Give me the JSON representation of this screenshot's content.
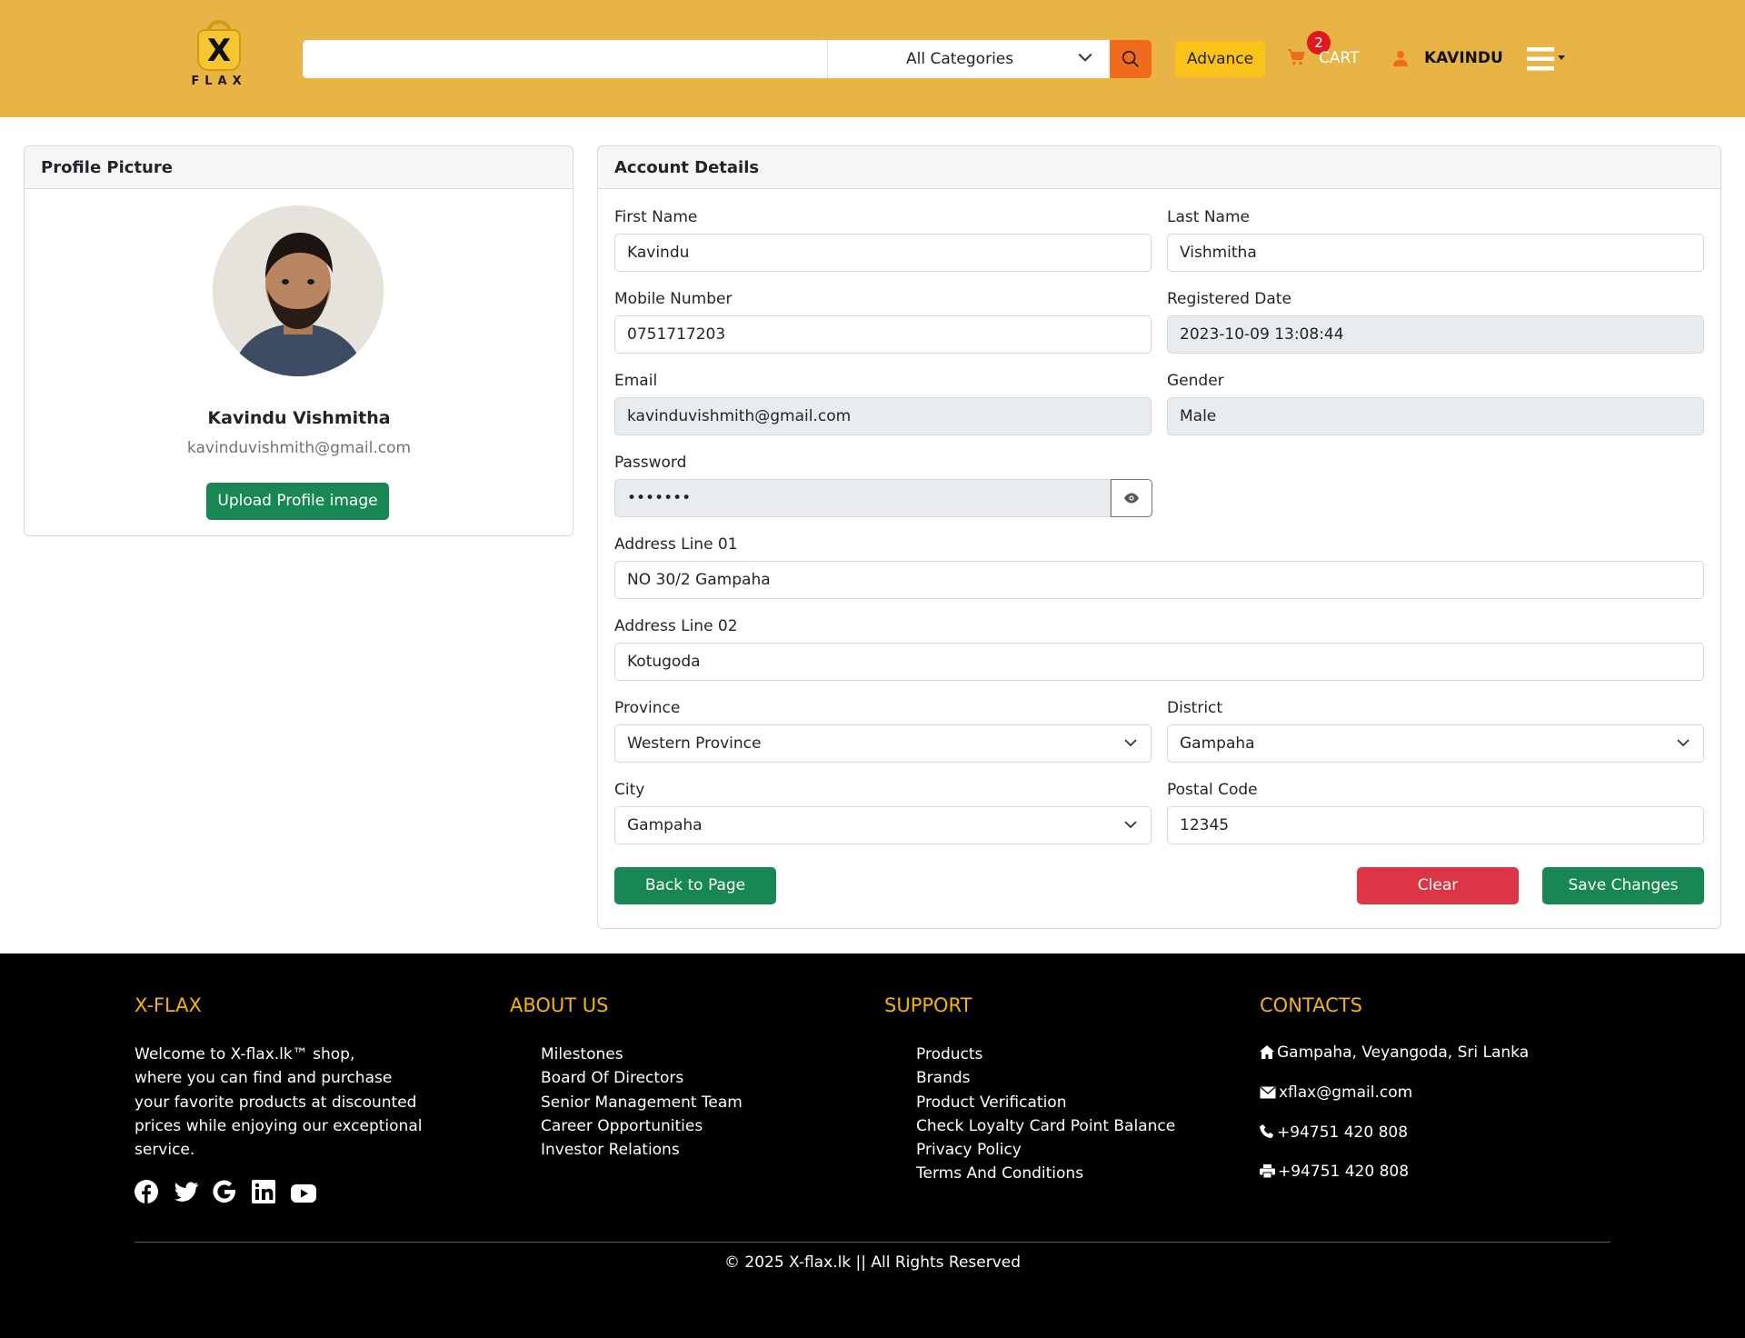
{
  "header": {
    "logo": {
      "letter": "X",
      "word": "FLAX"
    },
    "search": {
      "placeholder": "",
      "value": ""
    },
    "category": "All Categories",
    "advance_label": "Advance",
    "cart": {
      "label": "CART",
      "count": "2"
    },
    "user_label": "KAVINDU",
    "accent": "#e8b446"
  },
  "profile": {
    "card_title": "Profile Picture",
    "name": "Kavindu Vishmitha",
    "email": "kavinduvishmith@gmail.com",
    "upload_label": "Upload Profile image"
  },
  "account": {
    "card_title": "Account Details",
    "fields": {
      "first_name": {
        "label": "First Name",
        "value": "Kavindu"
      },
      "last_name": {
        "label": "Last Name",
        "value": "Vishmitha"
      },
      "mobile": {
        "label": "Mobile Number",
        "value": "0751717203"
      },
      "registered": {
        "label": "Registered Date",
        "value": "2023-10-09 13:08:44"
      },
      "email": {
        "label": "Email",
        "value": "kavinduvishmith@gmail.com"
      },
      "gender": {
        "label": "Gender",
        "value": "Male"
      },
      "password": {
        "label": "Password",
        "value": "•••••••"
      },
      "address1": {
        "label": "Address Line 01",
        "value": "NO 30/2 Gampaha"
      },
      "address2": {
        "label": "Address Line 02",
        "value": "Kotugoda"
      },
      "province": {
        "label": "Province",
        "value": "Western Province"
      },
      "district": {
        "label": "District",
        "value": "Gampaha"
      },
      "city": {
        "label": "City",
        "value": "Gampaha"
      },
      "postal": {
        "label": "Postal Code",
        "value": "12345"
      }
    },
    "buttons": {
      "back": "Back to Page",
      "clear": "Clear",
      "save": "Save Changes"
    }
  },
  "footer": {
    "brand": {
      "title": "X-FLAX",
      "lines": [
        "Welcome to X-flax.lk™ shop,",
        "where you can find and purchase",
        "your favorite products at discounted",
        "prices while enjoying our exceptional",
        "service."
      ]
    },
    "about": {
      "title": "ABOUT US",
      "items": [
        "Milestones",
        "Board Of Directors",
        "Senior Management Team",
        "Career Opportunities",
        "Investor Relations"
      ]
    },
    "support": {
      "title": "SUPPORT",
      "items": [
        "Products",
        "Brands",
        "Product Verification",
        "Check Loyalty Card Point Balance",
        "Privacy Policy",
        "Terms And Conditions"
      ]
    },
    "contacts": {
      "title": "CONTACTS",
      "address": "Gampaha, Veyangoda, Sri Lanka",
      "email": "xflax@gmail.com",
      "phone": "+94751 420 808",
      "fax": "+94751 420 808"
    },
    "social_icons": [
      "facebook-icon",
      "twitter-icon",
      "google-icon",
      "linkedin-icon",
      "youtube-icon"
    ],
    "copyright": "© 2025 X-flax.lk || All Rights Reserved"
  }
}
